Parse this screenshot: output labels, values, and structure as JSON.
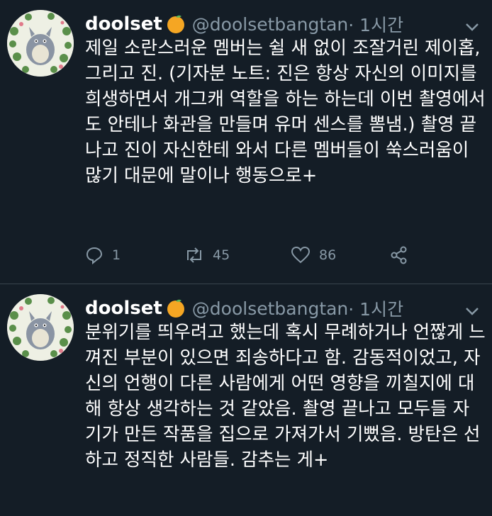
{
  "tweets": [
    {
      "name": "doolset",
      "handle": "@doolsetbangtan",
      "time": " · 1시간",
      "text": "제일 소란스러운 멤버는 쉴 새 없이 조잘거린 제이홉, 그리고 진. (기자분 노트: 진은 항상 자신의 이미지를 희생하면서 개그캐 역할을 하는 하는데 이번 촬영에서도 안테나 화관을 만들며 유머 센스를 뽐냄.) 촬영 끝나고 진이 자신한테 와서 다른 멤버들이 쑥스러움이 많기 대문에 말이나 행동으로+",
      "replies": "1",
      "retweets": "45",
      "likes": "86"
    },
    {
      "name": "doolset",
      "handle": "@doolsetbangtan",
      "time": " · 1시간",
      "text": "분위기를 띄우려고 했는데 혹시 무례하거나 언짢게 느껴진 부분이 있으면 죄송하다고 함. 감동적이었고, 자신의 언행이 다른 사람에게 어떤 영향을 끼칠지에 대해 항상 생각하는 것 같았음. 촬영 끝나고 모두들 자기가 만든 작품을 집으로 가져가서 기뻤음. 방탄은 선하고 정직한 사람들. 감추는 게+"
    }
  ],
  "colors": {
    "background": "#141d26",
    "secondary_text": "#8899a6",
    "divider": "#38444d",
    "badge": "#f5a623"
  },
  "icons": {
    "badge": "orange-emoji-icon",
    "reply": "reply-icon",
    "retweet": "retweet-icon",
    "like": "heart-icon",
    "share": "share-icon",
    "menu": "chevron-down-icon"
  }
}
